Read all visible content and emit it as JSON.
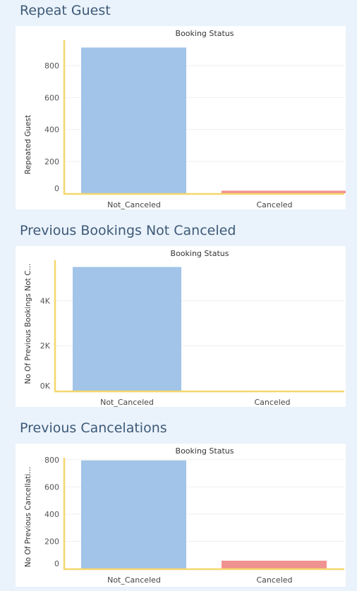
{
  "colors": {
    "not_canceled": "#a1c4e8",
    "canceled": "#f0928f",
    "axis": "#f5d76e",
    "grid": "#efefef"
  },
  "chart_data": [
    {
      "type": "bar",
      "section_title": "Repeat Guest",
      "header": "Booking Status",
      "ylabel": "Repeated Guest",
      "categories": [
        "Not_Canceled",
        "Canceled"
      ],
      "values": [
        914,
        16
      ],
      "ylim": [
        0,
        960
      ],
      "yticks": [
        0,
        200,
        400,
        600,
        800
      ],
      "ytick_labels": [
        "0",
        "200",
        "400",
        "600",
        "800"
      ],
      "grid": true
    },
    {
      "type": "bar",
      "section_title": "Previous Bookings Not Canceled",
      "header": "Booking Status",
      "ylabel": "No Of Previous Bookings Not C...",
      "categories": [
        "Not_Canceled",
        "Canceled"
      ],
      "values": [
        5500,
        0
      ],
      "ylim": [
        0,
        5800
      ],
      "yticks": [
        0,
        2000,
        4000
      ],
      "ytick_labels": [
        "0K",
        "2K",
        "4K"
      ],
      "grid": true
    },
    {
      "type": "bar",
      "section_title": "Previous Cancelations",
      "header": "Booking Status",
      "ylabel": "No Of Previous Cancellati...",
      "categories": [
        "Not_Canceled",
        "Canceled"
      ],
      "values": [
        795,
        57
      ],
      "ylim": [
        0,
        815
      ],
      "yticks": [
        0,
        200,
        400,
        600,
        800
      ],
      "ytick_labels": [
        "0",
        "200",
        "400",
        "600",
        "800"
      ],
      "grid": true
    }
  ]
}
